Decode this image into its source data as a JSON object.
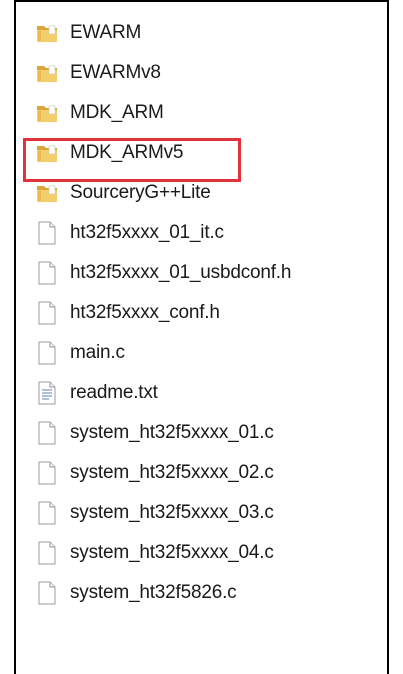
{
  "items": [
    {
      "name": "EWARM",
      "type": "folder",
      "icon": "folder-icon"
    },
    {
      "name": "EWARMv8",
      "type": "folder",
      "icon": "folder-icon"
    },
    {
      "name": "MDK_ARM",
      "type": "folder",
      "icon": "folder-icon"
    },
    {
      "name": "MDK_ARMv5",
      "type": "folder",
      "icon": "folder-icon",
      "highlighted": true
    },
    {
      "name": "SourceryG++Lite",
      "type": "folder",
      "icon": "folder-icon"
    },
    {
      "name": "ht32f5xxxx_01_it.c",
      "type": "file",
      "icon": "file-icon"
    },
    {
      "name": "ht32f5xxxx_01_usbdconf.h",
      "type": "file",
      "icon": "file-icon"
    },
    {
      "name": "ht32f5xxxx_conf.h",
      "type": "file",
      "icon": "file-icon"
    },
    {
      "name": "main.c",
      "type": "file",
      "icon": "file-icon"
    },
    {
      "name": "readme.txt",
      "type": "text",
      "icon": "text-file-icon"
    },
    {
      "name": "system_ht32f5xxxx_01.c",
      "type": "file",
      "icon": "file-icon"
    },
    {
      "name": "system_ht32f5xxxx_02.c",
      "type": "file",
      "icon": "file-icon"
    },
    {
      "name": "system_ht32f5xxxx_03.c",
      "type": "file",
      "icon": "file-icon"
    },
    {
      "name": "system_ht32f5xxxx_04.c",
      "type": "file",
      "icon": "file-icon"
    },
    {
      "name": "system_ht32f5826.c",
      "type": "file",
      "icon": "file-icon"
    }
  ],
  "colors": {
    "highlight": "#e3323b",
    "folder": "#e9c15a",
    "text": "#1a1a1a"
  }
}
